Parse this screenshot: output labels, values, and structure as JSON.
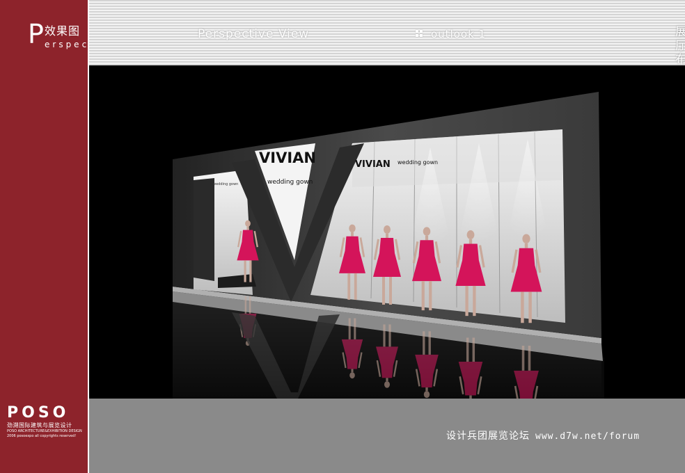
{
  "logo": {
    "letter": "P",
    "title_cn": "效果图",
    "subtitle": "erspective"
  },
  "header": {
    "title": "Perspective View",
    "subtitle": "outlook 1",
    "right_title": "展厅布置"
  },
  "render": {
    "brand_big": "VIVIAN",
    "brand_big_tagline": "wedding gown",
    "brand_small": "VIVIAN",
    "brand_small_tagline": "wedding gown",
    "brand_left_tagline": "wedding gown",
    "dress_color": "#d4145a",
    "mannequin_count": 6
  },
  "brand": {
    "name": "POSO",
    "name_cn": "劲溯国际建筑与展览设计",
    "name_en": "POSO ARCHITECTURE&EXHIBITION DESIGN",
    "copyright": "2006 posoexpo all copyrights reserved!"
  },
  "footer": {
    "text_cn": "设计兵团展览论坛",
    "url": "www.d7w.net/forum"
  },
  "colors": {
    "sidebar": "#8d232b",
    "footer": "#8a8a8a",
    "render_bg": "#000000"
  }
}
